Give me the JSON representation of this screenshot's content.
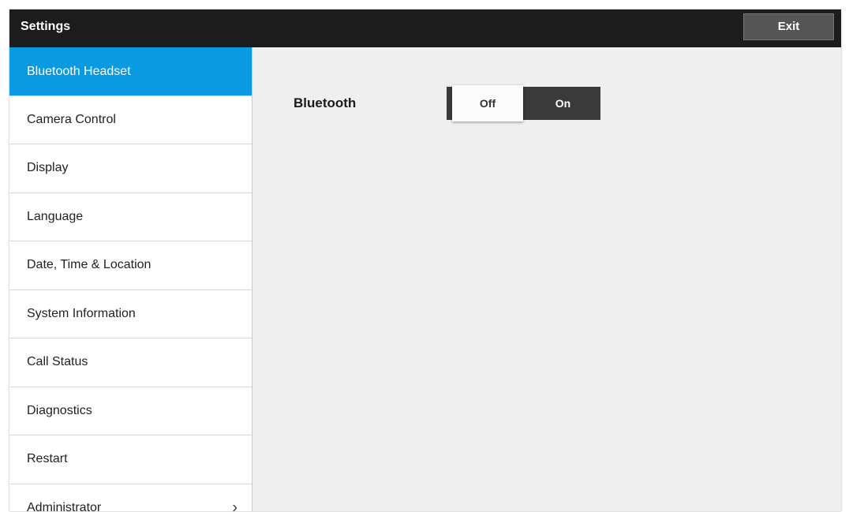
{
  "header": {
    "title": "Settings",
    "exit_label": "Exit"
  },
  "sidebar": {
    "items": [
      {
        "label": "Bluetooth Headset",
        "selected": true
      },
      {
        "label": "Camera Control"
      },
      {
        "label": "Display"
      },
      {
        "label": "Language"
      },
      {
        "label": "Date, Time & Location"
      },
      {
        "label": "System Information"
      },
      {
        "label": "Call Status"
      },
      {
        "label": "Diagnostics"
      },
      {
        "label": "Restart"
      },
      {
        "label": "Administrator",
        "has_submenu": true,
        "icon": "chevron-right-icon"
      }
    ]
  },
  "main": {
    "bluetooth_label": "Bluetooth",
    "toggle": {
      "off_label": "Off",
      "on_label": "On",
      "selected": "Off"
    }
  },
  "colors": {
    "accent": "#0a9ae2",
    "titlebar": "#1c1c1c",
    "content_bg": "#efefef"
  }
}
